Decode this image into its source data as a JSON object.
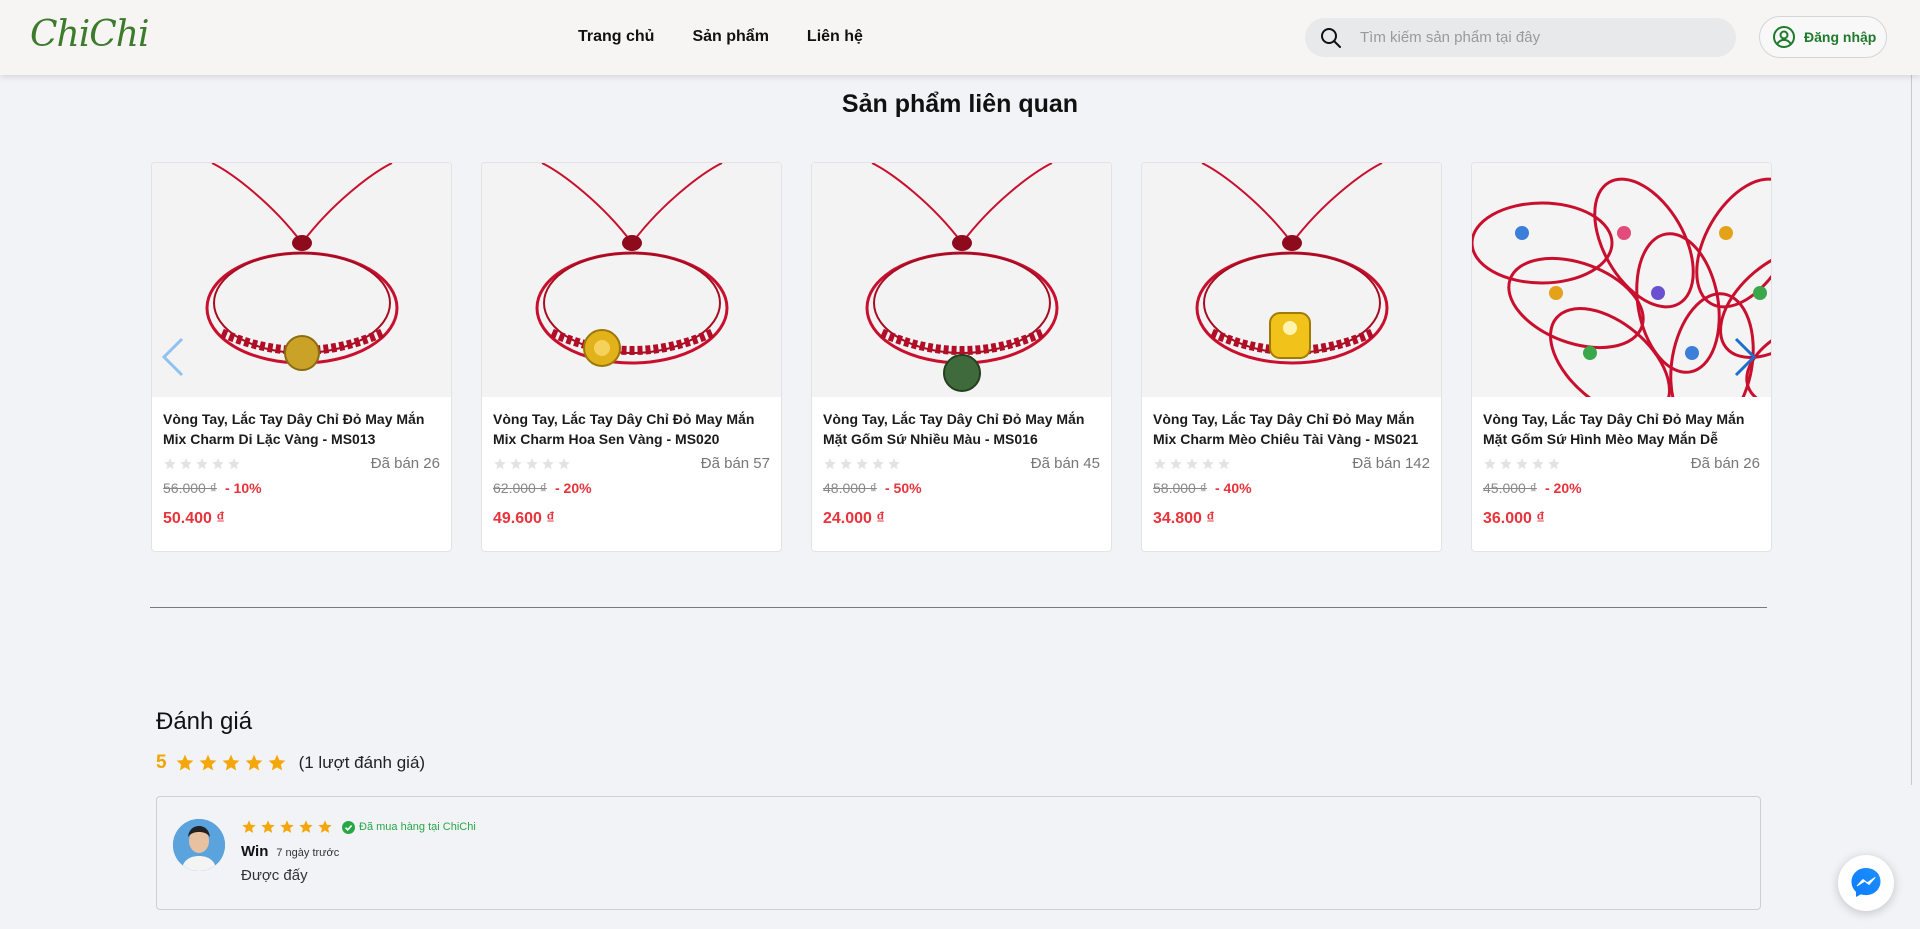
{
  "brand": {
    "logo": "ChiChi",
    "accent": "#3c7a2c",
    "price_color": "#e8333b"
  },
  "nav": {
    "home": "Trang chủ",
    "products": "Sản phẩm",
    "contact": "Liên hệ"
  },
  "search": {
    "placeholder": "Tìm kiếm sản phẩm tại đây"
  },
  "login": {
    "label": "Đăng nhập"
  },
  "related": {
    "title": "Sản phẩm liên quan",
    "items": [
      {
        "name": "Vòng Tay, Lắc Tay Dây Chỉ Đỏ May Mắn Mix Charm Di Lặc Vàng - MS013",
        "sold": "Đã bán 26",
        "old_price": "56.000 ₫",
        "discount": "- 10%",
        "price": "50.400 ₫",
        "rating": 0
      },
      {
        "name": "Vòng Tay, Lắc Tay Dây Chỉ Đỏ May Mắn Mix Charm Hoa Sen Vàng - MS020",
        "sold": "Đã bán 57",
        "old_price": "62.000 ₫",
        "discount": "- 20%",
        "price": "49.600 ₫",
        "rating": 0
      },
      {
        "name": "Vòng Tay, Lắc Tay Dây Chỉ Đỏ May Mắn Mặt Gốm Sứ Nhiều Màu - MS016",
        "sold": "Đã bán 45",
        "old_price": "48.000 ₫",
        "discount": "- 50%",
        "price": "24.000 ₫",
        "rating": 0
      },
      {
        "name": "Vòng Tay, Lắc Tay Dây Chỉ Đỏ May Mắn Mix Charm Mèo Chiêu Tài Vàng - MS021",
        "sold": "Đã bán 142",
        "old_price": "58.000 ₫",
        "discount": "- 40%",
        "price": "34.800 ₫",
        "rating": 0
      },
      {
        "name": "Vòng Tay, Lắc Tay Dây Chỉ Đỏ May Mắn Mặt Gốm Sứ Hình Mèo May Mắn Dễ Thương Nhiều Màu...",
        "sold": "Đã bán 26",
        "old_price": "45.000 ₫",
        "discount": "- 20%",
        "price": "36.000 ₫",
        "rating": 0
      }
    ]
  },
  "reviews": {
    "title": "Đánh giá",
    "score": "5",
    "star_rating": 5,
    "count_text": "(1 lượt đánh giá)",
    "items": [
      {
        "name": "Win",
        "time": "7 ngày trước",
        "verified": "Đã mua hàng tại ChiChi",
        "text": "Được đấy",
        "stars": 5
      }
    ]
  },
  "icons": {
    "search": "search-icon",
    "user": "user-circle-icon",
    "prev": "chevron-left-icon",
    "next": "chevron-right-icon",
    "messenger": "messenger-icon",
    "verified": "check-circle-icon",
    "star": "star-icon"
  }
}
